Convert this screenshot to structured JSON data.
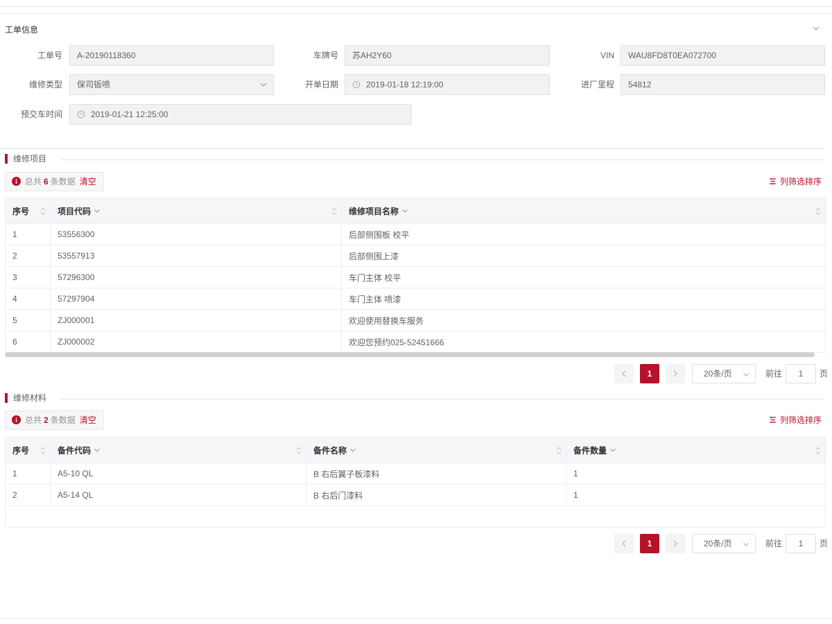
{
  "order_info": {
    "title": "工单信息",
    "fields": {
      "order_no": {
        "label": "工单号",
        "value": "A-20190118360"
      },
      "plate": {
        "label": "车牌号",
        "value": "苏AH2Y60"
      },
      "vin": {
        "label": "VIN",
        "value": "WAU8FD8T0EA072700"
      },
      "repair_type": {
        "label": "维修类型",
        "value": "保司钣喷"
      },
      "open_date": {
        "label": "开单日期",
        "value": "2019-01-18 12:19:00"
      },
      "mileage": {
        "label": "进厂里程",
        "value": "54812"
      },
      "delivery_time": {
        "label": "预交车时间",
        "value": "2019-01-21 12:25:00"
      }
    }
  },
  "repair_items": {
    "title": "维修项目",
    "summary": {
      "prefix": "总共",
      "count": "6",
      "suffix": "条数据",
      "clear": "清空"
    },
    "filter_label": "列筛选排序",
    "columns": [
      "序号",
      "项目代码",
      "维修项目名称"
    ],
    "rows": [
      [
        "1",
        "53556300",
        "后部侧围板 校平"
      ],
      [
        "2",
        "53557913",
        "后部侧围上漆"
      ],
      [
        "3",
        "57296300",
        "车门主体 校平"
      ],
      [
        "4",
        "57297904",
        "车门主体 喷漆"
      ],
      [
        "5",
        "ZJ000001",
        "欢迎使用替换车服务"
      ],
      [
        "6",
        "ZJ000002",
        "欢迎您预约025-52451666"
      ]
    ],
    "pager": {
      "current": "1",
      "page_size": "20条/页",
      "goto_label": "前往",
      "goto_value": "1",
      "page_unit": "页"
    }
  },
  "repair_materials": {
    "title": "维修材料",
    "summary": {
      "prefix": "总共",
      "count": "2",
      "suffix": "条数据",
      "clear": "清空"
    },
    "filter_label": "列筛选排序",
    "columns": [
      "序号",
      "备件代码",
      "备件名称",
      "备件数量"
    ],
    "rows": [
      [
        "1",
        "A5-10 QL",
        "B 右后翼子板漆料",
        "1"
      ],
      [
        "2",
        "A5-14 QL",
        "B 右后门漆料",
        "1"
      ]
    ],
    "pager": {
      "current": "1",
      "page_size": "20条/页",
      "goto_label": "前往",
      "goto_value": "1",
      "page_unit": "页"
    }
  },
  "theme": {
    "accent": "#b5132a"
  }
}
